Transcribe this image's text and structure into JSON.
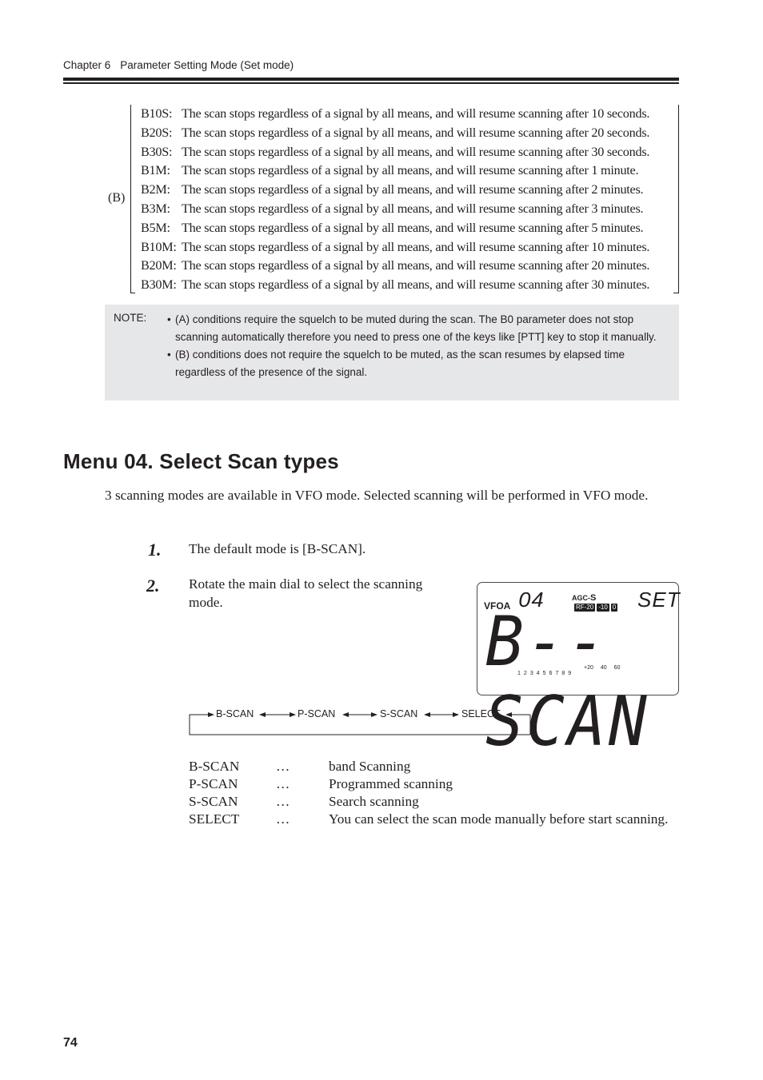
{
  "header": {
    "chapter": "Chapter 6",
    "chapter_title": "Parameter Setting Mode (Set mode)"
  },
  "conditions": {
    "group_label": "(B)",
    "items": [
      {
        "code": "B10S:",
        "text": "The scan stops regardless of a signal by all means, and will resume scanning after 10 seconds."
      },
      {
        "code": "B20S:",
        "text": "The scan stops regardless of a signal by all means, and will resume scanning after 20 seconds."
      },
      {
        "code": "B30S:",
        "text": "The scan stops regardless of a signal by all means, and will resume scanning after 30 seconds."
      },
      {
        "code": "B1M:",
        "text": "The scan stops regardless of a signal by all means, and will resume scanning after 1 minute."
      },
      {
        "code": "B2M:",
        "text": "The scan stops regardless of a signal by all means, and will resume scanning after 2 minutes."
      },
      {
        "code": "B3M:",
        "text": "The scan stops regardless of a signal by all means, and will resume scanning after 3 minutes."
      },
      {
        "code": "B5M:",
        "text": "The scan stops regardless of a signal by all means, and will resume scanning after 5 minutes."
      },
      {
        "code": "B10M:",
        "text": "The scan stops regardless of a signal by all means, and will resume scanning after 10 minutes."
      },
      {
        "code": "B20M:",
        "text": "The scan stops regardless of a signal by all means, and will resume scanning after 20 minutes."
      },
      {
        "code": "B30M:",
        "text": "The scan stops regardless of a signal by all means, and will resume scanning after 30 minutes."
      }
    ]
  },
  "note": {
    "label": "NOTE:",
    "bullet": "•",
    "items": [
      "(A) conditions require the squelch to be muted during the scan. The B0 parameter does not stop scanning automatically therefore you need to press one of the keys like [PTT] key to stop it manually.",
      "(B) conditions does not require the squelch to be muted, as the scan resumes by elapsed time regardless of the presence of the signal."
    ]
  },
  "section": {
    "title": "Menu 04.  Select Scan types",
    "intro": "3 scanning modes are available in VFO mode. Selected scanning will be performed in VFO mode."
  },
  "steps": [
    {
      "number": "1.",
      "text": "The default mode is [B-SCAN]."
    },
    {
      "number": "2.",
      "text": "Rotate the main dial to select the scanning mode."
    }
  ],
  "lcd": {
    "vfo": "VFO",
    "vfo_suffix": "A",
    "menu_number": "04",
    "agc": "AGC-",
    "agc_value": "S",
    "rf_labels": [
      "RF-20",
      "-10",
      "0"
    ],
    "set": "SET",
    "main_text": "B--SCAN",
    "s_scale": [
      "1",
      "2",
      "3",
      "4",
      "5",
      "6",
      "7",
      "8",
      "9"
    ],
    "db_scale": [
      "+20",
      "40",
      "60"
    ]
  },
  "flow": {
    "items": [
      "B-SCAN",
      "P-SCAN",
      "S-SCAN",
      "SELECT"
    ]
  },
  "definitions": [
    {
      "term": "B-SCAN",
      "dots": "…",
      "desc": "band Scanning"
    },
    {
      "term": "P-SCAN",
      "dots": "…",
      "desc": "Programmed scanning"
    },
    {
      "term": "S-SCAN",
      "dots": "…",
      "desc": "Search scanning"
    },
    {
      "term": "SELECT",
      "dots": "…",
      "desc": "You can select the scan mode manually before start scanning."
    }
  ],
  "page_number": "74"
}
